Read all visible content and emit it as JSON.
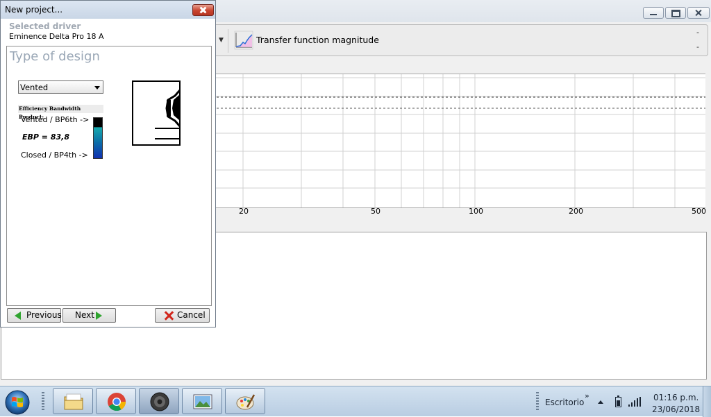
{
  "dialog": {
    "title": "New project...",
    "selected_driver_heading": "Selected driver",
    "driver_name": "Eminence Delta Pro 18 A",
    "section_title": "Type of design",
    "design_type_selected": "Vented",
    "ebp_heading": "Efficiency Bandwidth Product:",
    "ebp_vented_label": "Vented / BP6th ->",
    "ebp_value": "EBP = 83,8",
    "ebp_closed_label": "Closed / BP4th ->",
    "buttons": {
      "previous": "Previous",
      "next": "Next",
      "cancel": "Cancel"
    }
  },
  "toolbar": {
    "transfer_label": "Transfer function magnitude",
    "dash_top": "-",
    "dash_bottom": "-"
  },
  "graph": {
    "x_ticks": [
      "20",
      "50",
      "100",
      "200",
      "500"
    ]
  },
  "taskbar": {
    "apps": [
      "file-explorer",
      "chrome",
      "speaker-app",
      "photo-viewer",
      "paint"
    ],
    "tray_label": "Escritorio",
    "tray_chevron": "»",
    "clock_time": "01:16 p.m.",
    "clock_date": "23/06/2018"
  },
  "colors": {
    "accent_green": "#2fa42f",
    "cancel_red": "#d1261c",
    "title_gray": "#9aa7b6"
  }
}
